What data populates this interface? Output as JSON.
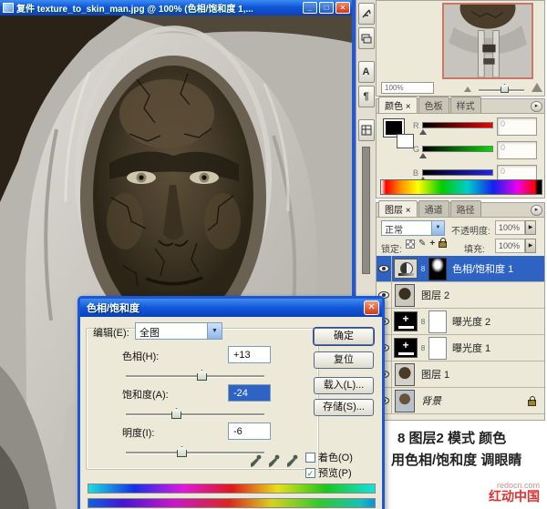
{
  "window": {
    "title": "复件 texture_to_skin_man.jpg @ 100% (色相/饱和度 1,..."
  },
  "icons": {
    "minimize": "_",
    "maximize": "□",
    "close": "✕",
    "dropdown_arrow": "▼",
    "spinner_arrow": "▶",
    "panel_menu": "▸",
    "check": "✓",
    "link": "8",
    "brush": "✎",
    "move": "+",
    "character_palette": "A",
    "paragraph_palette": "¶"
  },
  "navigator": {
    "zoom": "100%"
  },
  "color_panel": {
    "tabs": [
      "颜色 ×",
      "色板",
      "样式"
    ],
    "sliders": [
      {
        "label": "R",
        "value": "0"
      },
      {
        "label": "G",
        "value": "0"
      },
      {
        "label": "B",
        "value": "0"
      }
    ]
  },
  "layers_panel": {
    "tabs": [
      "图层 ×",
      "通道",
      "路径"
    ],
    "blend_mode": "正常",
    "opacity_label": "不透明度:",
    "opacity_value": "100%",
    "lock_label": "锁定:",
    "fill_label": "填充:",
    "fill_value": "100%",
    "layers": [
      {
        "name": "色相/饱和度 1",
        "type": "hue-saturation-adjustment",
        "selected": true
      },
      {
        "name": "图层 2",
        "type": "image"
      },
      {
        "name": "曝光度 2",
        "type": "exposure-adjustment"
      },
      {
        "name": "曝光度 1",
        "type": "exposure-adjustment"
      },
      {
        "name": "图层 1",
        "type": "image"
      },
      {
        "name": "背景",
        "type": "background",
        "locked": true
      }
    ]
  },
  "caption": {
    "line1": "8 图层2 模式 颜色",
    "line2": "用色相/饱和度 调眼睛"
  },
  "watermark": {
    "site": "redocn.com",
    "name": "红动中国"
  },
  "dialog": {
    "title": "色相/饱和度",
    "edit_label": "编辑(E):",
    "edit_value": "全图",
    "hue_label": "色相(H):",
    "hue_value": "+13",
    "sat_label": "饱和度(A):",
    "sat_value": "-24",
    "light_label": "明度(I):",
    "light_value": "-6",
    "btn_ok": "确定",
    "btn_reset": "复位",
    "btn_load": "载入(L)...",
    "btn_save": "存储(S)...",
    "chk_colorize": "着色(O)",
    "chk_preview": "预览(P)",
    "accent_blue": "#1a56d6",
    "selection_blue": "#2e63c4"
  }
}
